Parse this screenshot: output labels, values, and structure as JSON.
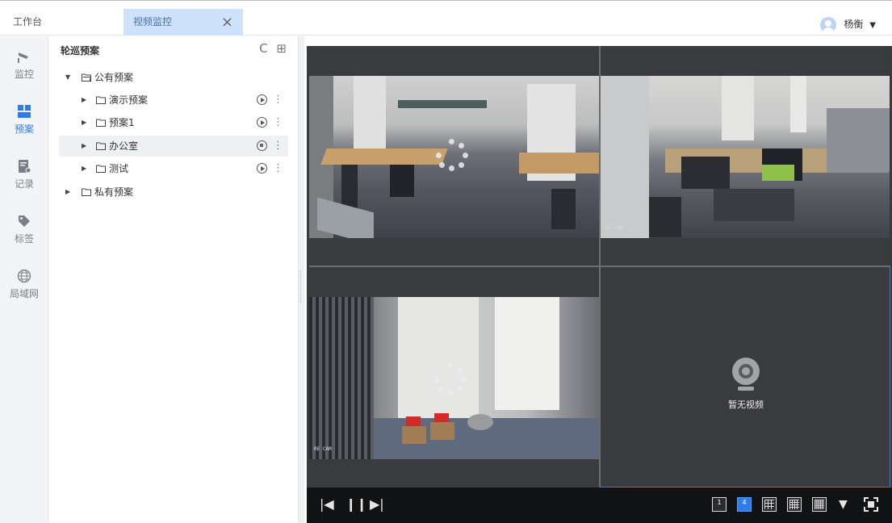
{
  "tabs": {
    "home": "工作台",
    "active": "视频监控",
    "close_symbol": "×"
  },
  "user": {
    "name": "杨衡",
    "caret": "▼"
  },
  "leftnav": [
    {
      "label": "监控",
      "icon": "camera-icon"
    },
    {
      "label": "预案",
      "icon": "layout-grid-icon",
      "active": true
    },
    {
      "label": "记录",
      "icon": "record-icon"
    },
    {
      "label": "标签",
      "icon": "tag-icon"
    },
    {
      "label": "局域网",
      "icon": "globe-icon"
    }
  ],
  "tree": {
    "title": "轮巡预案",
    "refresh_symbol": "C",
    "add_symbol": "⊞",
    "groups": [
      {
        "label": "公有预案",
        "expanded": true,
        "children": [
          {
            "label": "演示预案",
            "state": "play"
          },
          {
            "label": "预案1",
            "state": "play"
          },
          {
            "label": "办公室",
            "state": "stop",
            "selected": true
          },
          {
            "label": "测试",
            "state": "play"
          }
        ]
      },
      {
        "label": "私有预案",
        "expanded": false,
        "children": []
      }
    ]
  },
  "video": {
    "no_video_text": "暂无视频",
    "cam_tag": "RE CAM"
  },
  "controls": {
    "prev": "|◀",
    "pause": "❙❙",
    "next": "▶|",
    "layouts": [
      "1",
      "4",
      "9",
      "16",
      "25"
    ],
    "active_layout": "4"
  },
  "colors": {
    "accent": "#2f7be9",
    "tab_active_bg": "#cfe2fb",
    "video_bg": "#393a3d",
    "control_bar_bg": "#111214"
  }
}
